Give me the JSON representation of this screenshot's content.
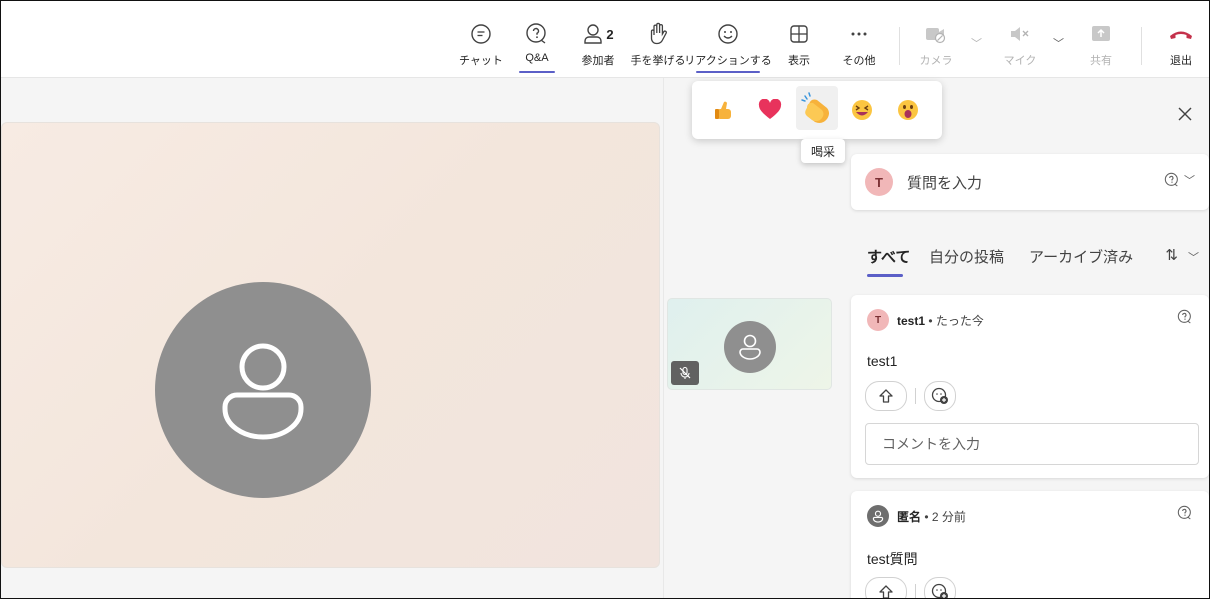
{
  "toolbar": {
    "items": [
      {
        "label": "チャット",
        "icon": "chat-icon"
      },
      {
        "label": "Q&A",
        "icon": "qa-icon"
      },
      {
        "label": "参加者",
        "icon": "participants-icon",
        "badge": "2"
      },
      {
        "label": "手を挙げる",
        "icon": "raise-hand-icon"
      },
      {
        "label": "リアクションする",
        "icon": "smiley-icon"
      },
      {
        "label": "表示",
        "icon": "grid-view-icon"
      },
      {
        "label": "その他",
        "icon": "more-icon"
      },
      {
        "label": "カメラ",
        "icon": "camera-off-icon"
      },
      {
        "label": "マイク",
        "icon": "mic-muted-icon"
      },
      {
        "label": "共有",
        "icon": "share-icon"
      },
      {
        "label": "退出",
        "icon": "leave-phone-icon"
      }
    ]
  },
  "reactions": {
    "emojis": [
      "thumbs-up",
      "heart",
      "clapping-hands",
      "laughing",
      "surprised"
    ],
    "tooltip": "喝采"
  },
  "qa_panel": {
    "ask_avatar": "T",
    "ask_placeholder": "質問を入力",
    "tabs": [
      "すべて",
      "自分の投稿",
      "アーカイブ済み"
    ],
    "sort_symbol": "⇅",
    "questions": [
      {
        "avatar": "T",
        "author": "test1",
        "time": "たった今",
        "text": "test1",
        "comment_placeholder": "コメントを入力"
      },
      {
        "author": "匿名",
        "time": "2 分前",
        "text": "test質問"
      }
    ]
  },
  "colors": {
    "accent": "#5b5fc7",
    "leave": "#c4314b",
    "avatar_gray": "#8f8f8f",
    "avatar_pink": "#f1b7b8"
  }
}
